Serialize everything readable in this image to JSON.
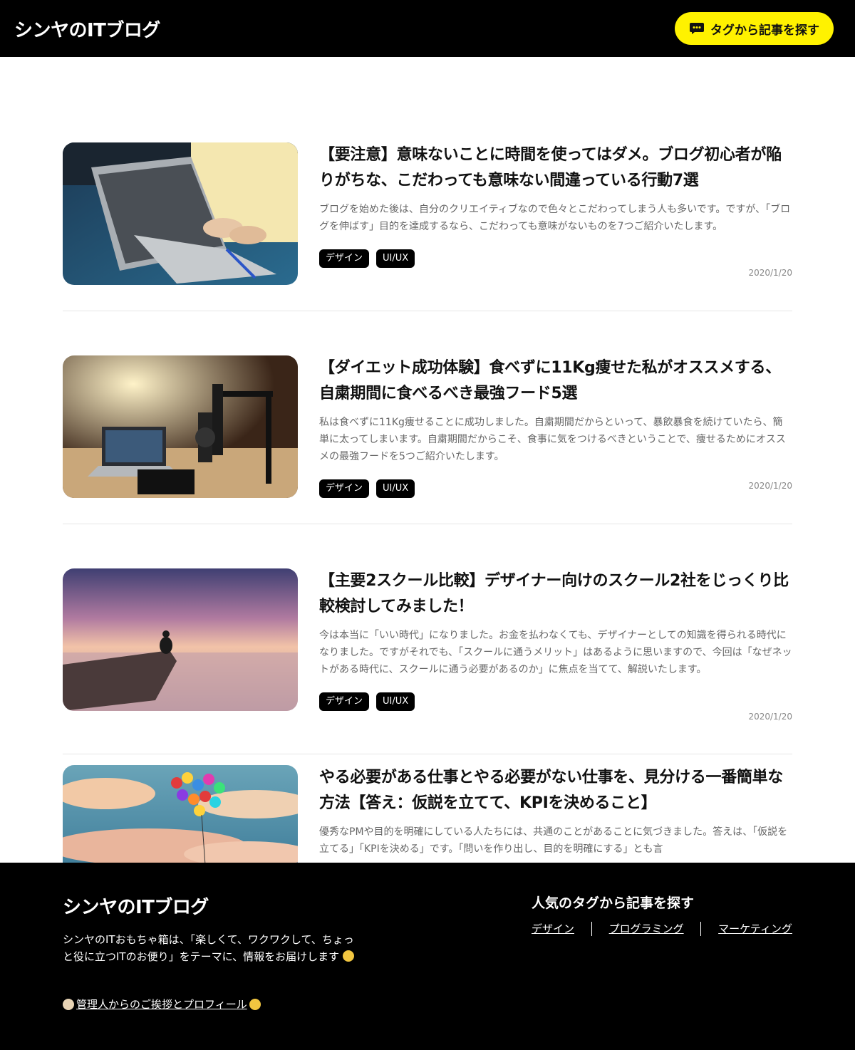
{
  "header": {
    "brand": "シンヤのITブログ",
    "tag_search_label": "タグから記事を探す",
    "tag_search_icon": "chat-bubble-icon",
    "accent_color": "#fff200"
  },
  "articles": [
    {
      "title": "【要注意】意味ないことに時間を使ってはダメ。ブログ初心者が陥りがちな、こだわっても意味ない間違っている行動7選",
      "excerpt": "ブログを始めた後は、自分のクリエイティブなので色々とこだわってしまう人も多いです。ですが、「ブログを伸ばす」目的を達成するなら、こだわっても意味がないものを7つご紹介いたします。",
      "tags": [
        "デザイン",
        "UI/UX"
      ],
      "date": "2020/1/20"
    },
    {
      "title": "【ダイエット成功体験】食べずに11Kg痩せた私がオススメする、自粛期間に食べるべき最強フード5選",
      "excerpt": "私は食べずに11Kg痩せることに成功しました。自粛期間だからといって、暴飲暴食を続けていたら、簡単に太ってしまいます。自粛期間だからこそ、食事に気をつけるべきということで、痩せるためにオススメの最強フードを5つご紹介いたします。",
      "tags": [
        "デザイン",
        "UI/UX"
      ],
      "date": "2020/1/20"
    },
    {
      "title": "【主要2スクール比較】デザイナー向けのスクール2社をじっくり比較検討してみました！",
      "excerpt": "今は本当に「いい時代」になりました。お金を払わなくても、デザイナーとしての知識を得られる時代になりました。ですがそれでも、「スクールに通うメリット」はあるように思いますので、今回は「なぜネットがある時代に、スクールに通う必要があるのか」に焦点を当てて、解説いたします。",
      "tags": [
        "デザイン",
        "UI/UX"
      ],
      "date": "2020/1/20"
    },
    {
      "title": "やる必要がある仕事とやる必要がない仕事を、見分ける一番簡単な方法【答え：仮説を立てて、KPIを決めること】",
      "excerpt": "優秀なPMや目的を明確にしている人たちには、共通のことがあることに気づきました。答えは、「仮説を立てる」「KPIを決める」です。「問いを作り出し、目的を明確にする」とも言"
    }
  ],
  "footer": {
    "brand": "シンヤのITブログ",
    "description": "シンヤのITおもちゃ箱は、「楽しくて、ワクワクして、ちょっと役に立つITのお便り」をテーマに、情報をお届けします",
    "profile_link": "管理人からのご挨拶とプロフィール",
    "tags_title": "人気のタグから記事を探す",
    "tag_links": [
      "デザイン",
      "プログラミング",
      "マーケティング"
    ]
  }
}
